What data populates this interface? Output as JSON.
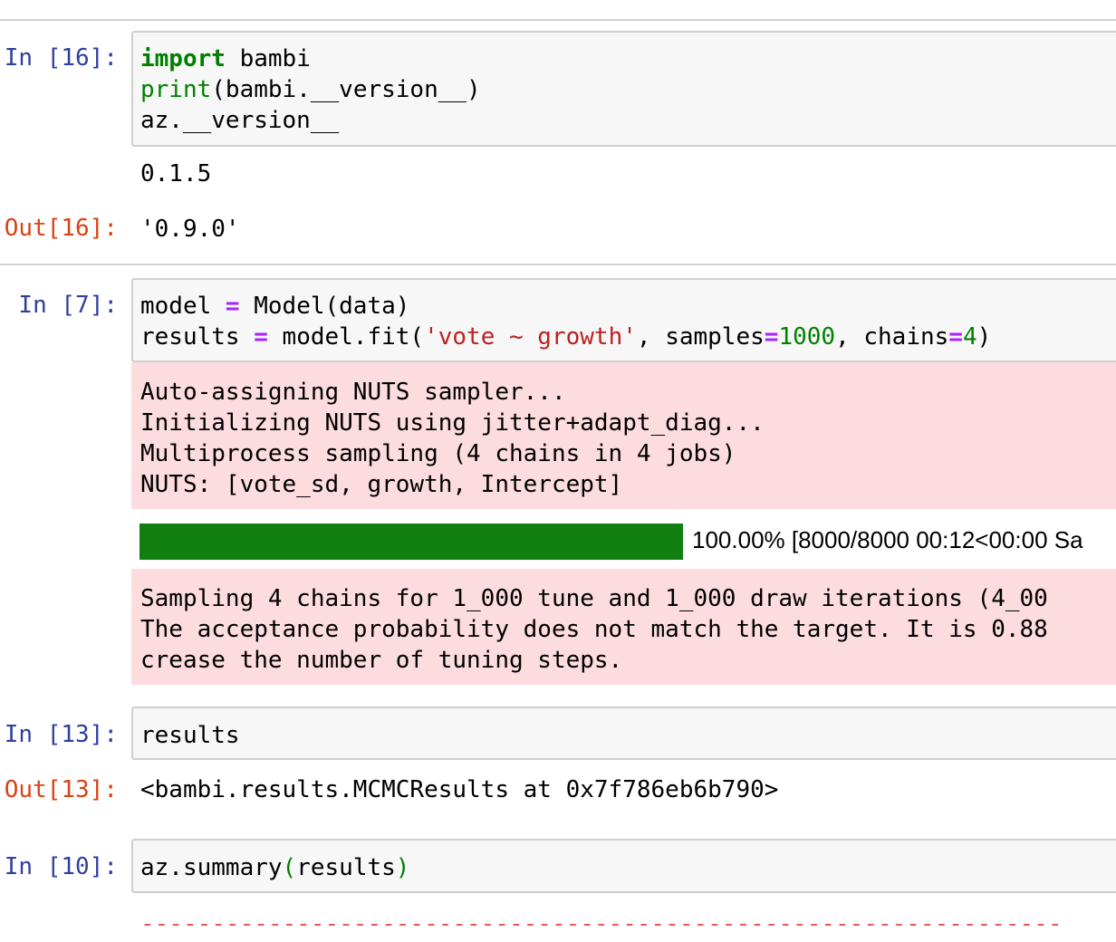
{
  "cells": [
    {
      "in_prompt": "In [16]:",
      "code_lines": [
        "import bambi",
        "print(bambi.__version__)",
        "az.__version__"
      ],
      "stdout": "0.1.5",
      "out_prompt": "Out[16]:",
      "out_value": "'0.9.0'"
    },
    {
      "in_prompt": "In [7]:",
      "code_lines": [
        "model = Model(data)",
        "results = model.fit('vote ~ growth', samples=1000, chains=4)"
      ],
      "stderr_1": [
        "Auto-assigning NUTS sampler...",
        "Initializing NUTS using jitter+adapt_diag...",
        "Multiprocess sampling (4 chains in 4 jobs)",
        "NUTS: [vote_sd, growth, Intercept]"
      ],
      "progress": {
        "percent": 100,
        "text": "100.00% [8000/8000 00:12<00:00 Sa",
        "color": "#107f10"
      },
      "stderr_2": [
        "Sampling 4 chains for 1_000 tune and 1_000 draw iterations (4_00",
        "The acceptance probability does not match the target. It is 0.88",
        "crease the number of tuning steps."
      ]
    },
    {
      "in_prompt": "In [13]:",
      "code_lines": [
        "results"
      ],
      "out_prompt": "Out[13]:",
      "out_value": "<bambi.results.MCMCResults at 0x7f786eb6b790>"
    },
    {
      "in_prompt": "In [10]:",
      "code_lines": [
        "az.summary(results)"
      ],
      "error_rule": "-----------------------------------------------------------------"
    }
  ]
}
